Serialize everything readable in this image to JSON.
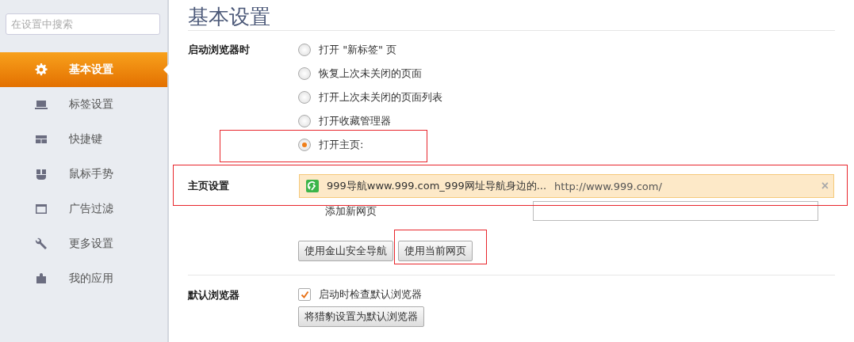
{
  "sidebar": {
    "search": {
      "placeholder": "在设置中搜索"
    },
    "items": [
      {
        "label": "基本设置",
        "selected": true
      },
      {
        "label": "标签设置",
        "selected": false
      },
      {
        "label": "快捷键",
        "selected": false
      },
      {
        "label": "鼠标手势",
        "selected": false
      },
      {
        "label": "广告过滤",
        "selected": false
      },
      {
        "label": "更多设置",
        "selected": false
      },
      {
        "label": "我的应用",
        "selected": false
      }
    ]
  },
  "page": {
    "title": "基本设置",
    "startup": {
      "label": "启动浏览器时",
      "options": [
        {
          "label": "打开 \"新标签\" 页",
          "selected": false,
          "highlighted": false
        },
        {
          "label": "恢复上次未关闭的页面",
          "selected": false,
          "highlighted": false
        },
        {
          "label": "打开上次未关闭的页面列表",
          "selected": false,
          "highlighted": false
        },
        {
          "label": "打开收藏管理器",
          "selected": false,
          "highlighted": false
        },
        {
          "label": "打开主页:",
          "selected": true,
          "highlighted": true
        }
      ]
    },
    "homepage": {
      "label": "主页设置",
      "highlighted": true,
      "entry": {
        "title": "999导航www.999.com_999网址导航身边的...",
        "url": "http://www.999.com/",
        "remove": "×"
      },
      "add_label": "添加新网页",
      "buttons": [
        {
          "label": "使用金山安全导航",
          "highlighted": false
        },
        {
          "label": "使用当前网页",
          "highlighted": true
        }
      ]
    },
    "default_browser": {
      "label": "默认浏览器",
      "check": {
        "label": "启动时检查默认浏览器",
        "checked": true
      },
      "button": "将猎豹设置为默认浏览器"
    }
  }
}
